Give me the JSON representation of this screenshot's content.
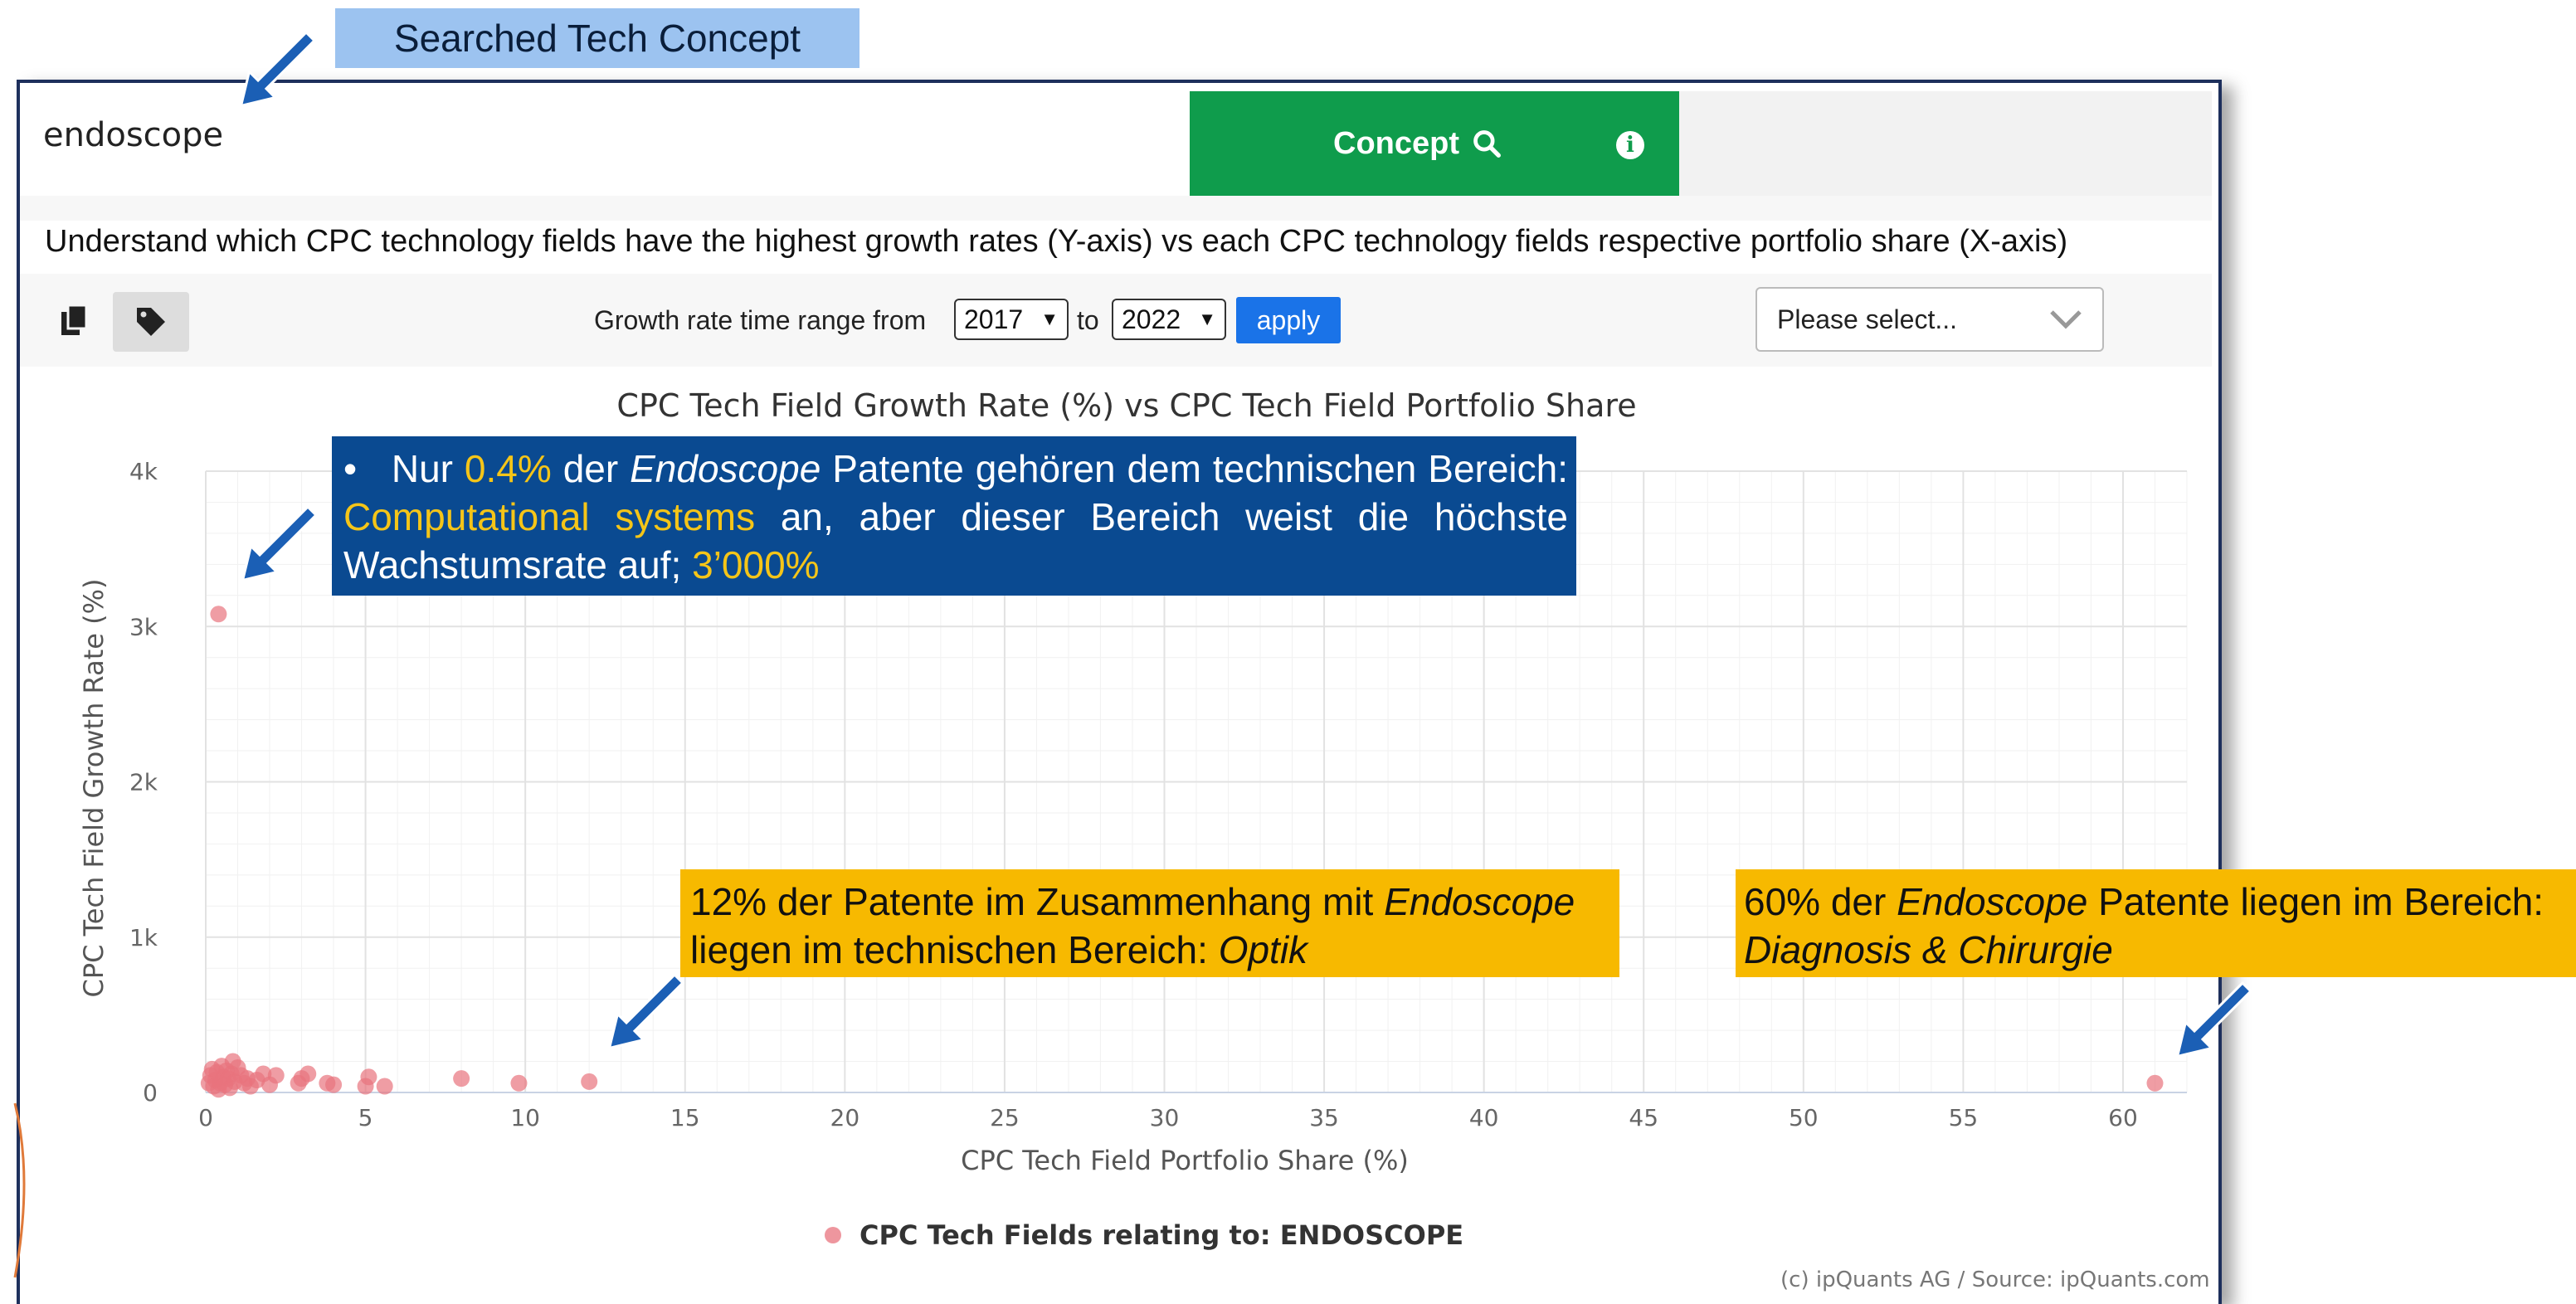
{
  "annotation_label": "Searched Tech Concept",
  "search": {
    "value": "endoscope",
    "button_label": "Concept"
  },
  "description": "Understand which CPC technology fields have the highest growth rates (Y-axis) vs each CPC technology fields respective portfolio share (X-axis)",
  "toolbar": {
    "range_label": "Growth rate time range from",
    "year_from": "2017",
    "to_label": "to",
    "year_to": "2022",
    "apply_label": "apply",
    "dropdown_placeholder": "Please select..."
  },
  "callouts": {
    "blue": {
      "bullet": "•",
      "t1": "Nur ",
      "h1": "0.4%",
      "t2": " der ",
      "i1": "Endoscope",
      "t3": " Patente gehören dem technischen Bereich: ",
      "h2": "Computational systems",
      "t4": " an, aber dieser Bereich weist die höchste Wachstumsrate auf; ",
      "h3": "3’000%"
    },
    "optik": {
      "t1": "12% der Patente im Zusammenhang mit ",
      "i1": "Endoscope",
      "t2": " liegen im technischen Bereich: ",
      "i2": "Optik"
    },
    "diag": {
      "t1": "60% der ",
      "i1": "Endoscope",
      "t2": " Patente liegen im Bereich: ",
      "i2": "Diagnosis & Chirurgie"
    }
  },
  "copyright": "(c) ipQuants AG / Source: ipQuants.com",
  "colors": {
    "point": "#e8737e",
    "callout_blue": "#0a4a91",
    "callout_yellow": "#f7b900",
    "highlight": "#f5c518",
    "button_green": "#0f9c4c",
    "apply_blue": "#1a73e8",
    "frame": "#1d2f5c",
    "arrow": "#1b5fb5"
  },
  "chart_data": {
    "type": "scatter",
    "title": "CPC Tech Field Growth Rate (%) vs CPC Tech Field Portfolio Share",
    "xlabel": "CPC Tech Field Portfolio Share (%)",
    "ylabel": "CPC Tech Field Growth Rate (%)",
    "xlim": [
      0,
      62
    ],
    "ylim": [
      0,
      4000
    ],
    "x_ticks": [
      0,
      5,
      10,
      15,
      20,
      25,
      30,
      35,
      40,
      45,
      50,
      55,
      60
    ],
    "y_ticks": [
      0,
      1000,
      2000,
      3000,
      4000
    ],
    "y_tick_labels": [
      "0",
      "1k",
      "2k",
      "3k",
      "4k"
    ],
    "grid": true,
    "legend_position": "bottom-center",
    "series": [
      {
        "name": "CPC Tech Fields relating to: ENDOSCOPE",
        "points": [
          [
            0.4,
            3080
          ],
          [
            0.1,
            60
          ],
          [
            0.15,
            110
          ],
          [
            0.2,
            150
          ],
          [
            0.25,
            40
          ],
          [
            0.3,
            80
          ],
          [
            0.35,
            130
          ],
          [
            0.4,
            20
          ],
          [
            0.45,
            60
          ],
          [
            0.5,
            170
          ],
          [
            0.55,
            100
          ],
          [
            0.6,
            50
          ],
          [
            0.65,
            140
          ],
          [
            0.7,
            90
          ],
          [
            0.75,
            30
          ],
          [
            0.8,
            120
          ],
          [
            0.85,
            200
          ],
          [
            0.9,
            70
          ],
          [
            1.0,
            160
          ],
          [
            1.1,
            110
          ],
          [
            1.2,
            60
          ],
          [
            1.3,
            90
          ],
          [
            1.4,
            40
          ],
          [
            1.6,
            80
          ],
          [
            1.8,
            120
          ],
          [
            2.0,
            50
          ],
          [
            2.2,
            110
          ],
          [
            2.9,
            60
          ],
          [
            3.0,
            90
          ],
          [
            3.2,
            120
          ],
          [
            3.8,
            60
          ],
          [
            4.0,
            50
          ],
          [
            5.0,
            40
          ],
          [
            5.1,
            100
          ],
          [
            5.6,
            40
          ],
          [
            8.0,
            90
          ],
          [
            9.8,
            60
          ],
          [
            12.0,
            70
          ],
          [
            61.0,
            60
          ]
        ]
      }
    ]
  }
}
